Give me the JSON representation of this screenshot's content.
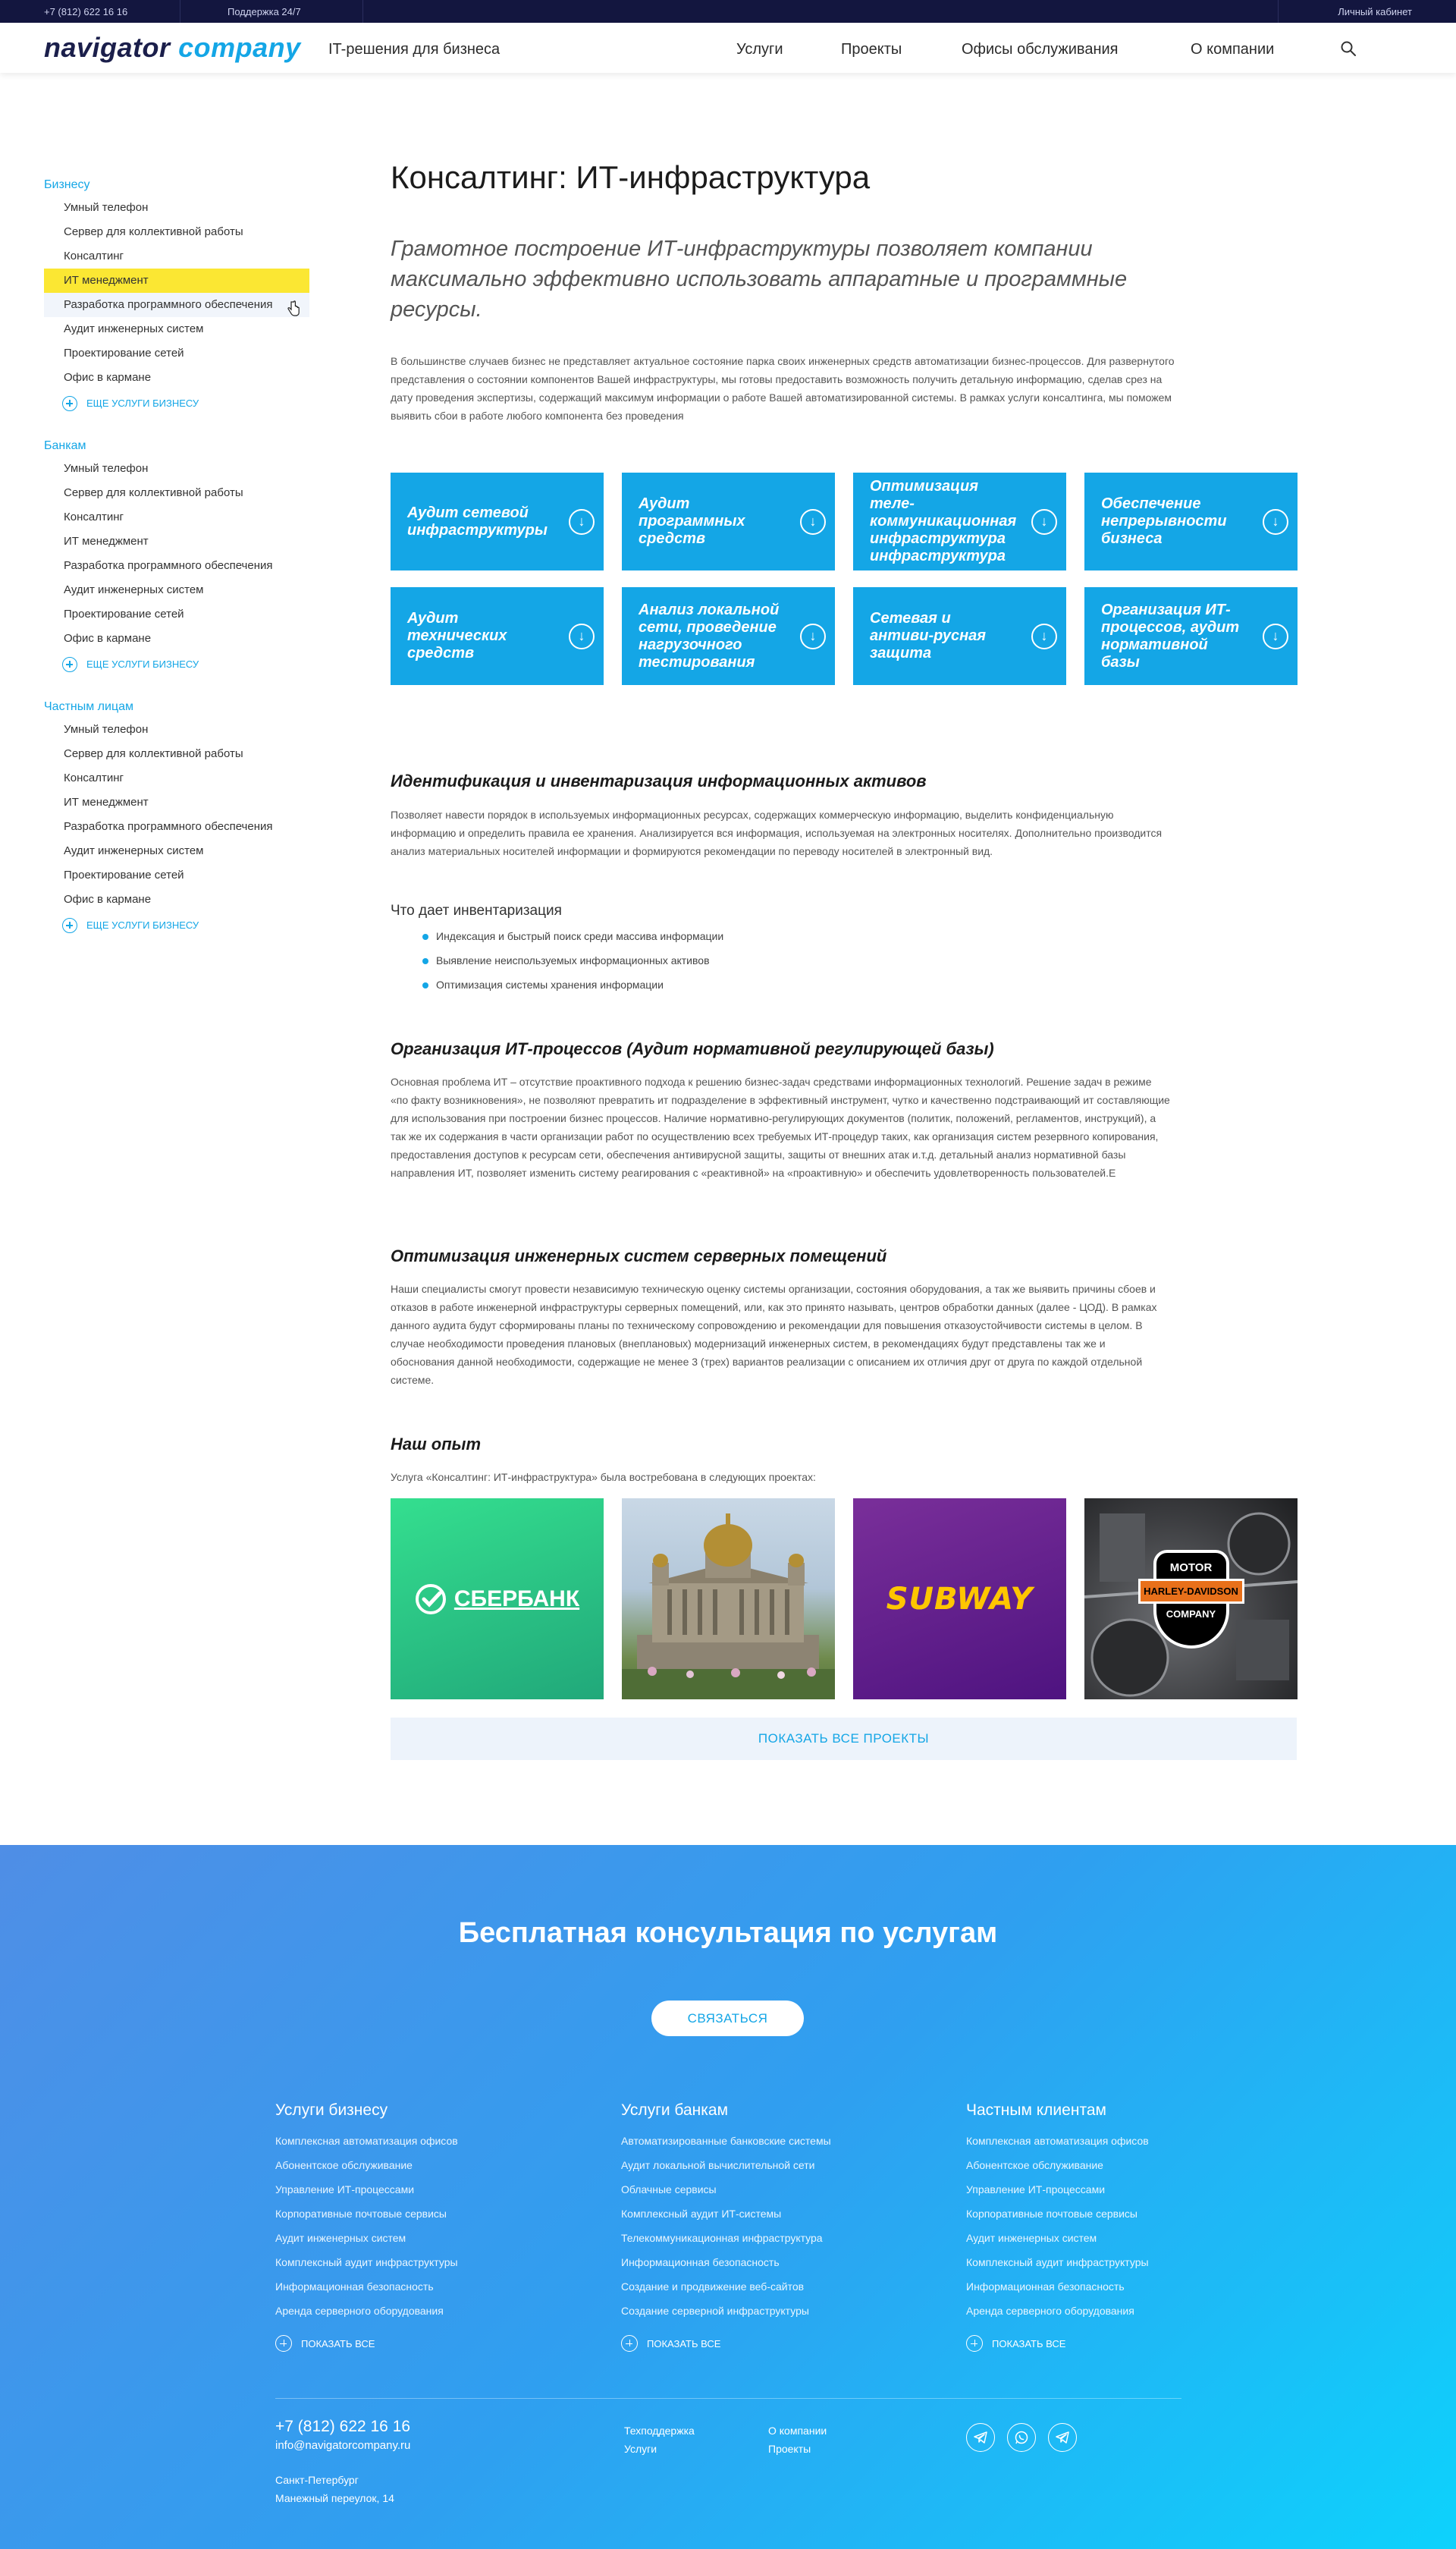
{
  "topbar": {
    "phone": "+7 (812) 622 16 16",
    "support": "Поддержка 24/7",
    "cabinet": "Личный кабинет"
  },
  "header": {
    "logo_word1": "navigator",
    "logo_word2": "company",
    "tagline": "IT-решения для бизнеса",
    "nav": [
      "Услуги",
      "Проекты",
      "Офисы обслуживания",
      "О компании"
    ]
  },
  "sidebar": {
    "groups": [
      {
        "title": "Бизнесу",
        "items": [
          "Умный телефон",
          "Сервер для коллективной работы",
          "Консалтинг",
          "ИТ менеджмент",
          "Разработка программного обеспечения",
          "Аудит инженерных систем",
          "Проектирование сетей",
          "Офис в кармане"
        ],
        "more": "ЕЩЕ УСЛУГИ БИЗНЕСУ"
      },
      {
        "title": "Банкам",
        "items": [
          "Умный телефон",
          "Сервер для коллективной работы",
          "Консалтинг",
          "ИТ менеджмент",
          "Разработка программного обеспечения",
          "Аудит инженерных систем",
          "Проектирование сетей",
          "Офис в кармане"
        ],
        "more": "ЕЩЕ УСЛУГИ БИЗНЕСУ"
      },
      {
        "title": "Частным лицам",
        "items": [
          "Умный телефон",
          "Сервер для коллективной работы",
          "Консалтинг",
          "ИТ менеджмент",
          "Разработка программного обеспечения",
          "Аудит инженерных систем",
          "Проектирование сетей",
          "Офис в кармане"
        ],
        "more": "ЕЩЕ УСЛУГИ БИЗНЕСУ"
      }
    ]
  },
  "main": {
    "title": "Консалтинг: ИТ-инфраструктура",
    "lead": "Грамотное построение ИТ-инфраструктуры позволяет компании максимально эффективно использовать аппаратные и программные ресурсы.",
    "intro": "В большинстве случаев бизнес не представляет актуальное состояние парка своих инженерных средств автоматизации бизнес-процессов. Для развернутого представления о состоянии компонентов Вашей инфраструктуры, мы готовы предоставить возможность получить детальную информацию, сделав срез на дату проведения экспертизы, содержащий максимум информации о работе Вашей автоматизированной системы. В рамках услуги консалтинга, мы поможем выявить сбои в работе любого компонента без проведения",
    "tiles": [
      "Аудит сетевой инфраструктуры",
      "Аудит программных средств",
      "Оптимизация теле-коммуникационная инфраструктура инфраструктура",
      "Обеспечение непрерывности бизнеса",
      "Аудит технических средств",
      "Анализ локальной сети, проведение нагрузочного тестирования",
      "Сетевая и антиви-русная защита",
      "Организация ИТ-процессов, аудит нормативной базы"
    ],
    "s1_title": "Идентификация и инвентаризация информационных активов",
    "s1_text": "Позволяет навести порядок в используемых информационных ресурсах, содержащих коммерческую информацию, выделить конфиденциальную информацию и определить правила ее хранения. Анализируется вся информация, используемая на электронных носителях. Дополнительно производится анализ материальных носителей информации и формируются рекомендации по переводу носителей в электронный вид.",
    "s1_sub": "Что дает инвентаризация",
    "s1_bullets": [
      "Индексация и быстрый поиск среди массива информации",
      "Выявление неиспользуемых информационных активов",
      "Оптимизация системы хранения информации"
    ],
    "s2_title": "Организация ИТ-процессов (Аудит нормативной регулирующей базы)",
    "s2_text": "Основная проблема ИТ – отсутствие проактивного подхода к решению бизнес-задач средствами информационных технологий. Решение задач в режиме «по факту возникновения», не позволяют превратить ит подразделение в эффективный инструмент, чутко и качественно подстраивающий ит составляющие для использования при построении бизнес процессов. Наличие нормативно-регулирующих документов (политик, положений, регламентов, инструкций), а так же их содержания в части организации работ по осуществлению всех требуемых ИТ-процедур таких, как организация систем резервного копирования, предоставления доступов к ресурсам сети, обеспечения антивирусной защиты, защиты от внешних атак и.т.д. детальный анализ нормативной базы направления ИТ, позволяет изменить систему реагирования с «реактивной» на «проактивную» и обеспечить удовлетворенность пользователей.Е",
    "s3_title": "Оптимизация инженерных систем серверных помещений",
    "s3_text": "Наши специалисты смогут провести независимую техническую оценку системы организации, состояния оборудования, а так же выявить причины сбоев и отказов в работе инженерной инфраструктуры серверных помещений, или, как это принято называть, центров обработки данных (далее - ЦОД). В рамках данного аудита будут сформированы планы по техническому сопровождению и рекомендации для повышения отказоустойчивости системы в целом. В случае необходимости проведения плановых (внеплановых) модернизаций инженерных систем, в рекомендациях будут представлены так же и обоснования данной необходимости, содержащие не менее 3 (трех) вариантов реализации с описанием их отличия друг от друга по каждой отдельной системе.",
    "exp_title": "Наш опыт",
    "exp_text": "Услуга «Консалтинг: ИТ-инфраструктура» была востребована в следующих проектах:",
    "projects": {
      "sber": "СБЕРБАНК",
      "subway": "SUBWAY",
      "harley_top": "MOTOR",
      "harley_mid": "HARLEY-DAVIDSON",
      "harley_bot": "COMPANY"
    },
    "show_all": "ПОКАЗАТЬ ВСЕ ПРОЕКТЫ"
  },
  "footer": {
    "title": "Бесплатная консультация по услугам",
    "button": "СВЯЗАТЬСЯ",
    "columns": [
      {
        "title": "Услуги бизнесу",
        "items": [
          "Комплексная автоматизация офисов",
          "Абонентское обслуживание",
          "Управление ИТ-процессами",
          "Корпоративные почтовые сервисы",
          "Аудит инженерных систем",
          "Комплексный аудит инфраструктуры",
          "Информационная безопасность",
          "Аренда серверного оборудования"
        ],
        "more": "ПОКАЗАТЬ ВСЕ"
      },
      {
        "title": "Услуги банкам",
        "items": [
          "Автоматизированные банковские системы",
          "Аудит локальной вычислительной сети",
          "Облачные сервисы",
          "Комплексный аудит ИТ-системы",
          "Телекоммуникационная инфраструктура",
          "Информационная безопасность",
          "Создание и продвижение веб-сайтов",
          "Создание серверной инфраструктуры"
        ],
        "more": "ПОКАЗАТЬ ВСЕ"
      },
      {
        "title": "Частным клиентам",
        "items": [
          "Комплексная автоматизация офисов",
          "Абонентское обслуживание",
          "Управление ИТ-процессами",
          "Корпоративные почтовые сервисы",
          "Аудит инженерных систем",
          "Комплексный аудит инфраструктуры",
          "Информационная безопасность",
          "Аренда серверного оборудования"
        ],
        "more": "ПОКАЗАТЬ ВСЕ"
      }
    ],
    "phone": "+7 (812) 622 16 16",
    "email": "info@navigatorcompany.ru",
    "city": "Санкт-Петербург",
    "address": "Манежный переулок, 14",
    "links": [
      "Техподдержка",
      "Услуги",
      "О компании",
      "Проекты"
    ],
    "socials": [
      "telegram-icon",
      "whatsapp-icon",
      "send-icon"
    ]
  },
  "colors": {
    "accent": "#14a6e6",
    "topbar": "#13163f",
    "highlight": "#fbe733"
  }
}
